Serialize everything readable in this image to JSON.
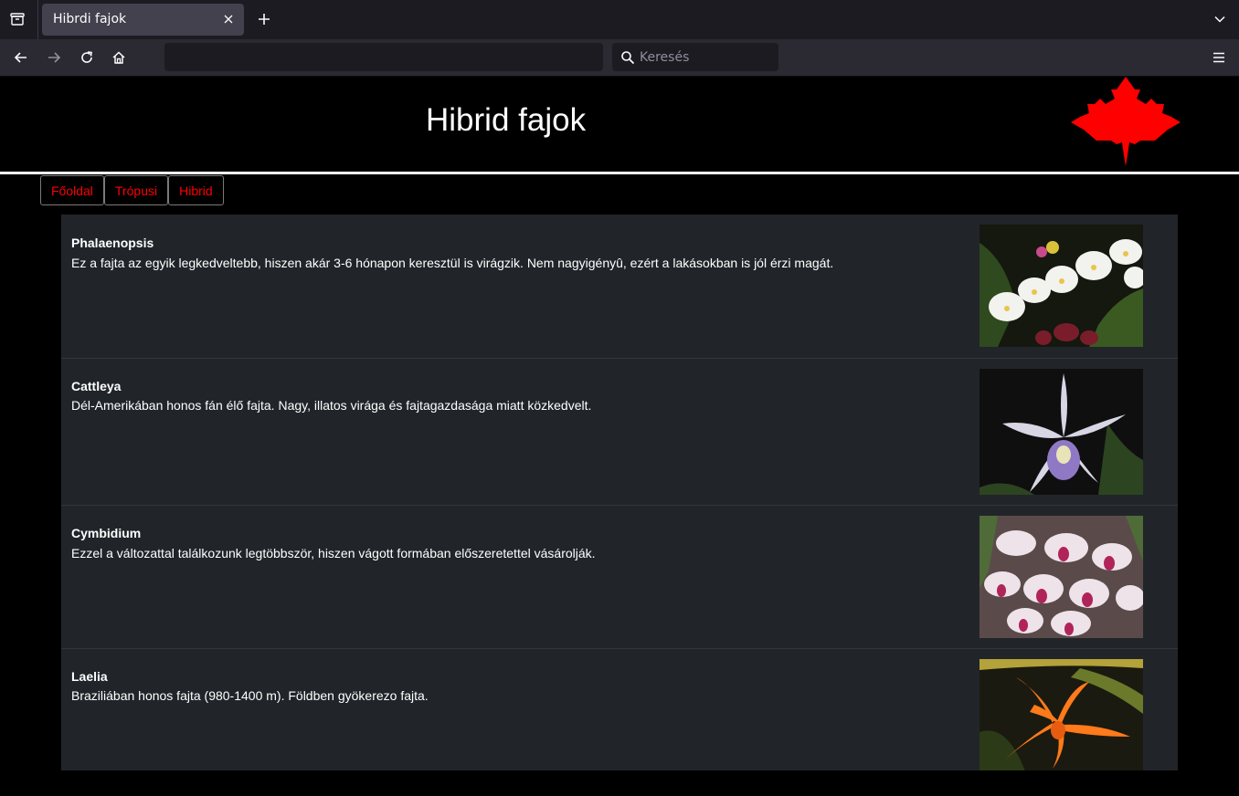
{
  "browser": {
    "tab_title": "Hibrdi fajok",
    "search_placeholder": "Keresés",
    "url": ""
  },
  "page": {
    "title": "Hibrid fajok",
    "nav": [
      {
        "label": "Főoldal"
      },
      {
        "label": "Trópusi"
      },
      {
        "label": "Hibrid"
      }
    ],
    "species": [
      {
        "name": "Phalaenopsis",
        "description": "Ez a fajta az egyik legkedveltebb, hiszen akár 3-6 hónapon keresztül is virágzik. Nem nagyigényû, ezért a lakásokban is jól érzi magát."
      },
      {
        "name": "Cattleya",
        "description": "Dél-Amerikában honos fán élő fajta. Nagy, illatos virága és fajtagazdasága miatt közkedvelt."
      },
      {
        "name": "Cymbidium",
        "description": "Ezzel a változattal találkozunk legtöbbször, hiszen vágott formában előszeretettel vásárolják."
      },
      {
        "name": "Laelia",
        "description": "Braziliában honos fajta (980-1400 m). Földben gyökerezo fajta."
      }
    ]
  },
  "colors": {
    "nav_link": "#ff0000",
    "logo": "#ff0000",
    "card_bg": "#212529"
  }
}
